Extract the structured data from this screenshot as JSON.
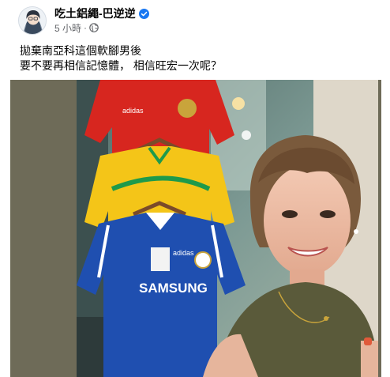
{
  "post": {
    "author": "吃土鋁繩-巴逆逆",
    "time": "5 小時",
    "separator": "·",
    "caption_lines": [
      "拋棄南亞科這個軟腳男後",
      "要不要再相信記憶體， 相信旺宏一次呢？"
    ],
    "jersey_text": "SAMSUNG"
  },
  "icons": {
    "verified": "verified-badge-icon",
    "audience": "globe-icon"
  },
  "colors": {
    "author_text": "#050505",
    "meta_text": "#65676b",
    "verified_blue": "#1877f2",
    "photo_side_bars": "#6e6b58",
    "jersey_red": "#d7261f",
    "jersey_yellow": "#f4c518",
    "jersey_blue": "#1f4fb0"
  }
}
